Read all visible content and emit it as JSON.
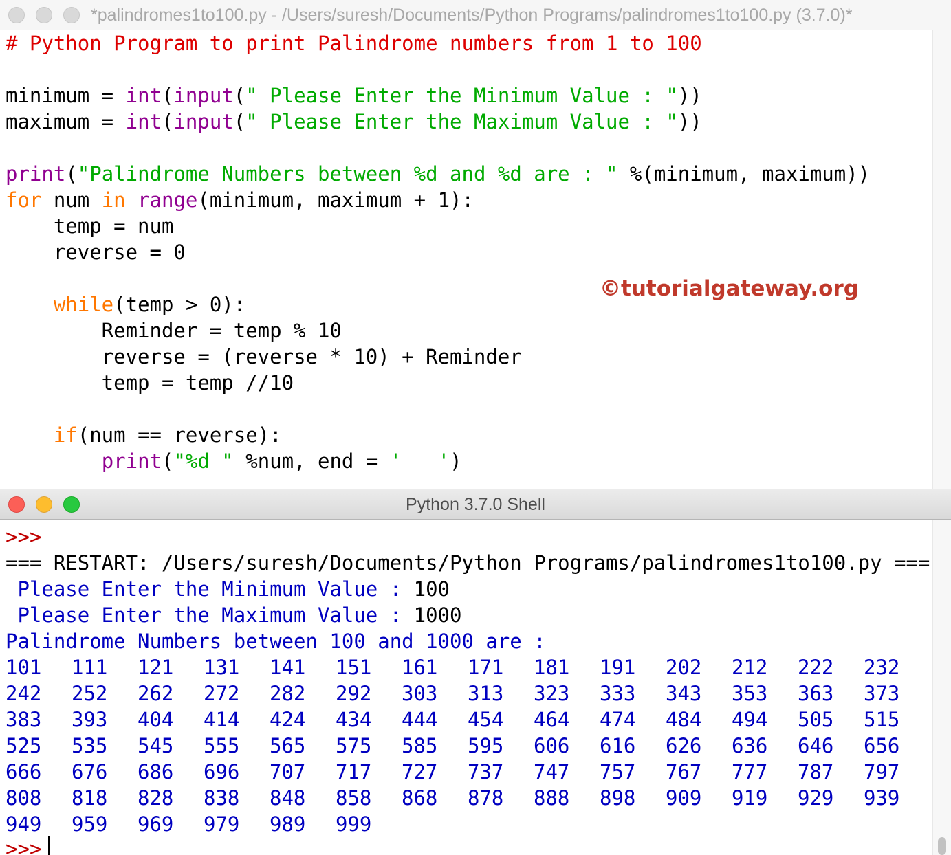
{
  "editor": {
    "title": "*palindromes1to100.py - /Users/suresh/Documents/Python Programs/palindromes1to100.py (3.7.0)*",
    "watermark": "©tutorialgateway.org",
    "lines": [
      [
        {
          "t": "# Python Program to print Palindrome numbers from 1 to 100",
          "c": "comment"
        }
      ],
      [],
      [
        {
          "t": "minimum = ",
          "c": ""
        },
        {
          "t": "int",
          "c": "builtin"
        },
        {
          "t": "(",
          "c": ""
        },
        {
          "t": "input",
          "c": "builtin"
        },
        {
          "t": "(",
          "c": ""
        },
        {
          "t": "\" Please Enter the Minimum Value : \"",
          "c": "str"
        },
        {
          "t": "))",
          "c": ""
        }
      ],
      [
        {
          "t": "maximum = ",
          "c": ""
        },
        {
          "t": "int",
          "c": "builtin"
        },
        {
          "t": "(",
          "c": ""
        },
        {
          "t": "input",
          "c": "builtin"
        },
        {
          "t": "(",
          "c": ""
        },
        {
          "t": "\" Please Enter the Maximum Value : \"",
          "c": "str"
        },
        {
          "t": "))",
          "c": ""
        }
      ],
      [],
      [
        {
          "t": "print",
          "c": "builtin"
        },
        {
          "t": "(",
          "c": ""
        },
        {
          "t": "\"Palindrome Numbers between %d and %d are : \"",
          "c": "str"
        },
        {
          "t": " %(minimum, maximum))",
          "c": ""
        }
      ],
      [
        {
          "t": "for",
          "c": "kw"
        },
        {
          "t": " num ",
          "c": ""
        },
        {
          "t": "in",
          "c": "kw"
        },
        {
          "t": " ",
          "c": ""
        },
        {
          "t": "range",
          "c": "builtin"
        },
        {
          "t": "(minimum, maximum + 1):",
          "c": ""
        }
      ],
      [
        {
          "t": "    temp = num",
          "c": ""
        }
      ],
      [
        {
          "t": "    reverse = 0",
          "c": ""
        }
      ],
      [],
      [
        {
          "t": "    ",
          "c": ""
        },
        {
          "t": "while",
          "c": "kw"
        },
        {
          "t": "(temp > 0):",
          "c": ""
        }
      ],
      [
        {
          "t": "        Reminder = temp % 10",
          "c": ""
        }
      ],
      [
        {
          "t": "        reverse = (reverse * 10) + Reminder",
          "c": ""
        }
      ],
      [
        {
          "t": "        temp = temp //10",
          "c": ""
        }
      ],
      [],
      [
        {
          "t": "    ",
          "c": ""
        },
        {
          "t": "if",
          "c": "kw"
        },
        {
          "t": "(num == reverse):",
          "c": ""
        }
      ],
      [
        {
          "t": "        ",
          "c": ""
        },
        {
          "t": "print",
          "c": "builtin"
        },
        {
          "t": "(",
          "c": ""
        },
        {
          "t": "\"%d \"",
          "c": "str"
        },
        {
          "t": " %num, end = ",
          "c": ""
        },
        {
          "t": "'   '",
          "c": "str"
        },
        {
          "t": ")",
          "c": ""
        }
      ]
    ]
  },
  "shell": {
    "title": "Python 3.7.0 Shell",
    "prompt": ">>>",
    "restart_line": "=== RESTART: /Users/suresh/Documents/Python Programs/palindromes1to100.py ===",
    "input_min": {
      "prompt": " Please Enter the Minimum Value : ",
      "value": "100"
    },
    "input_max": {
      "prompt": " Please Enter the Maximum Value : ",
      "value": "1000"
    },
    "result_header": "Palindrome Numbers between 100 and 1000 are :",
    "numbers": [
      "101",
      "111",
      "121",
      "131",
      "141",
      "151",
      "161",
      "171",
      "181",
      "191",
      "202",
      "212",
      "222",
      "232",
      "242",
      "252",
      "262",
      "272",
      "282",
      "292",
      "303",
      "313",
      "323",
      "333",
      "343",
      "353",
      "363",
      "373",
      "383",
      "393",
      "404",
      "414",
      "424",
      "434",
      "444",
      "454",
      "464",
      "474",
      "484",
      "494",
      "505",
      "515",
      "525",
      "535",
      "545",
      "555",
      "565",
      "575",
      "585",
      "595",
      "606",
      "616",
      "626",
      "636",
      "646",
      "656",
      "666",
      "676",
      "686",
      "696",
      "707",
      "717",
      "727",
      "737",
      "747",
      "757",
      "767",
      "777",
      "787",
      "797",
      "808",
      "818",
      "828",
      "838",
      "848",
      "858",
      "868",
      "878",
      "888",
      "898",
      "909",
      "919",
      "929",
      "939",
      "949",
      "959",
      "969",
      "979",
      "989",
      "999"
    ],
    "final_prompt": ">>>"
  }
}
